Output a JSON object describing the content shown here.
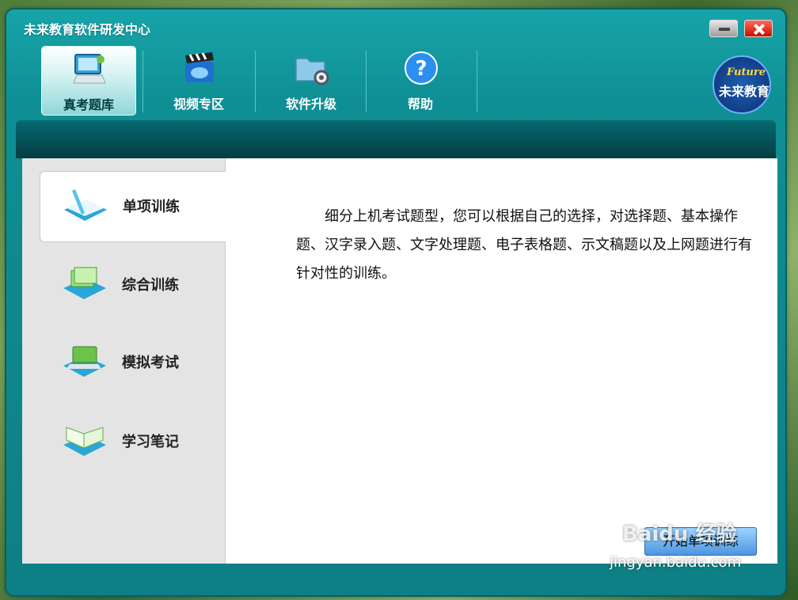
{
  "window": {
    "title": "未来教育软件研发中心"
  },
  "toolbar": {
    "items": [
      {
        "label": "真考题库",
        "icon": "monitor-icon"
      },
      {
        "label": "视频专区",
        "icon": "film-clapper-icon"
      },
      {
        "label": "软件升级",
        "icon": "folder-gear-icon"
      },
      {
        "label": "帮助",
        "icon": "help-icon"
      }
    ]
  },
  "brand": {
    "logo_top": "Future",
    "logo_bottom": "未来教育"
  },
  "sidebar": {
    "items": [
      {
        "label": "单项训练",
        "icon": "pen-book-icon"
      },
      {
        "label": "综合训练",
        "icon": "stack-books-icon"
      },
      {
        "label": "模拟考试",
        "icon": "laptop-icon"
      },
      {
        "label": "学习笔记",
        "icon": "notebook-icon"
      }
    ]
  },
  "main": {
    "description": "细分上机考试题型，您可以根据自己的选择，对选择题、基本操作题、汉字录入题、文字处理题、电子表格题、示文稿题以及上网题进行有针对性的训练。",
    "start_button": "开始单项训练"
  },
  "watermark": {
    "brand": "Baidu 经验",
    "url": "jingyan.baidu.com"
  },
  "colors": {
    "window": "#0f8f94",
    "dark_bar": "#044a50",
    "button": "#4c96e0"
  }
}
